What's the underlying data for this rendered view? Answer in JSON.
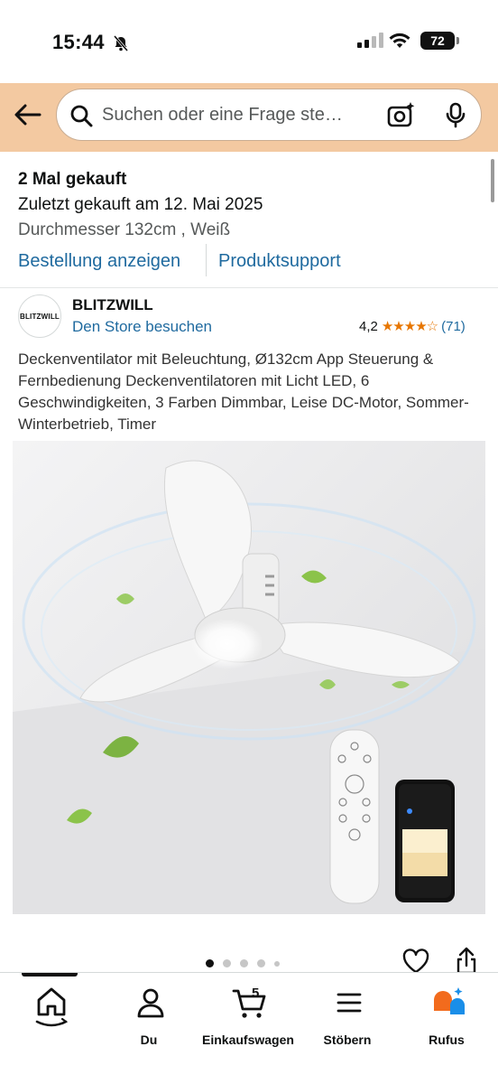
{
  "status": {
    "time": "15:44",
    "battery": "72"
  },
  "search": {
    "placeholder": "Suchen oder eine Frage ste…"
  },
  "order": {
    "bought": "2 Mal gekauft",
    "last": "Zuletzt gekauft am 12. Mai 2025",
    "variant": "Durchmesser 132cm , Weiß",
    "view_order": "Bestellung anzeigen",
    "support": "Produktsupport"
  },
  "brand": {
    "logo_text": "BLITZWILL",
    "name": "BLITZWILL",
    "store_link": "Den Store besuchen"
  },
  "rating": {
    "value": "4,2",
    "stars": 4.2,
    "count": "(71)"
  },
  "product": {
    "title": "Deckenventilator mit Beleuchtung, Ø132cm App Steuerung & Fernbedienung Deckenventilatoren mit Licht LED, 6 Geschwindigkeiten, 3 Farben Dimmbar, Leise DC-Motor, Sommer-Winterbetrieb, Timer"
  },
  "gallery": {
    "current": 1,
    "total": 5
  },
  "tabs": [
    {
      "label": "",
      "icon": "home-icon"
    },
    {
      "label": "Du",
      "icon": "person-icon"
    },
    {
      "label": "Einkaufswagen",
      "icon": "cart-icon",
      "badge": "5"
    },
    {
      "label": "Stöbern",
      "icon": "menu-icon"
    },
    {
      "label": "Rufus",
      "icon": "rufus-icon"
    }
  ],
  "colors": {
    "header": "#f3c9a1",
    "link": "#1f6a9f",
    "star": "#e77600"
  }
}
